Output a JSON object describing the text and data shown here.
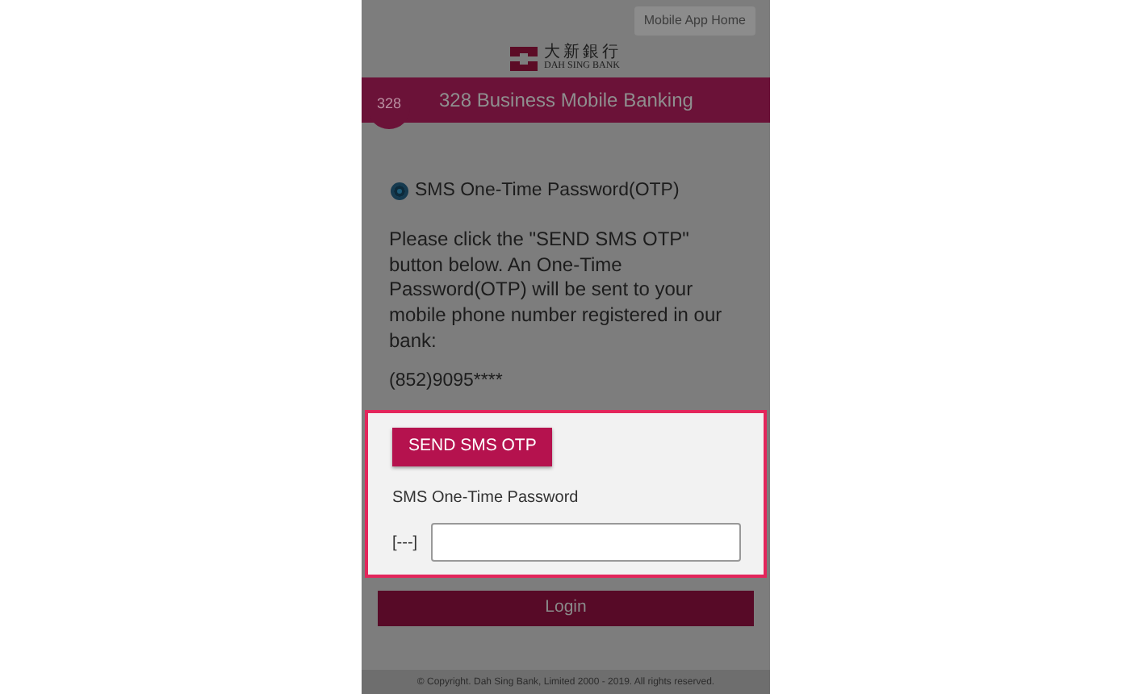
{
  "top_link": "Mobile App Home",
  "logo": {
    "chinese": "大新銀行",
    "english": "DAH SING BANK"
  },
  "header": {
    "badge": "328",
    "title": "328 Business Mobile Banking"
  },
  "otp_option": {
    "label": "SMS One-Time Password(OTP)",
    "selected": true
  },
  "instructions": "Please click the \"SEND SMS OTP\" button below. An One-Time Password(OTP) will be sent to your mobile phone number registered in our bank:",
  "phone": "(852)9095****",
  "otp_box": {
    "send_button": "SEND SMS OTP",
    "field_label": "SMS One-Time Password",
    "prefix": "[---]",
    "highlighted": true
  },
  "login_button": {
    "label": "Login",
    "disabled": true
  },
  "footer": "© Copyright. Dah Sing Bank, Limited 2000 - 2019. All rights reserved."
}
